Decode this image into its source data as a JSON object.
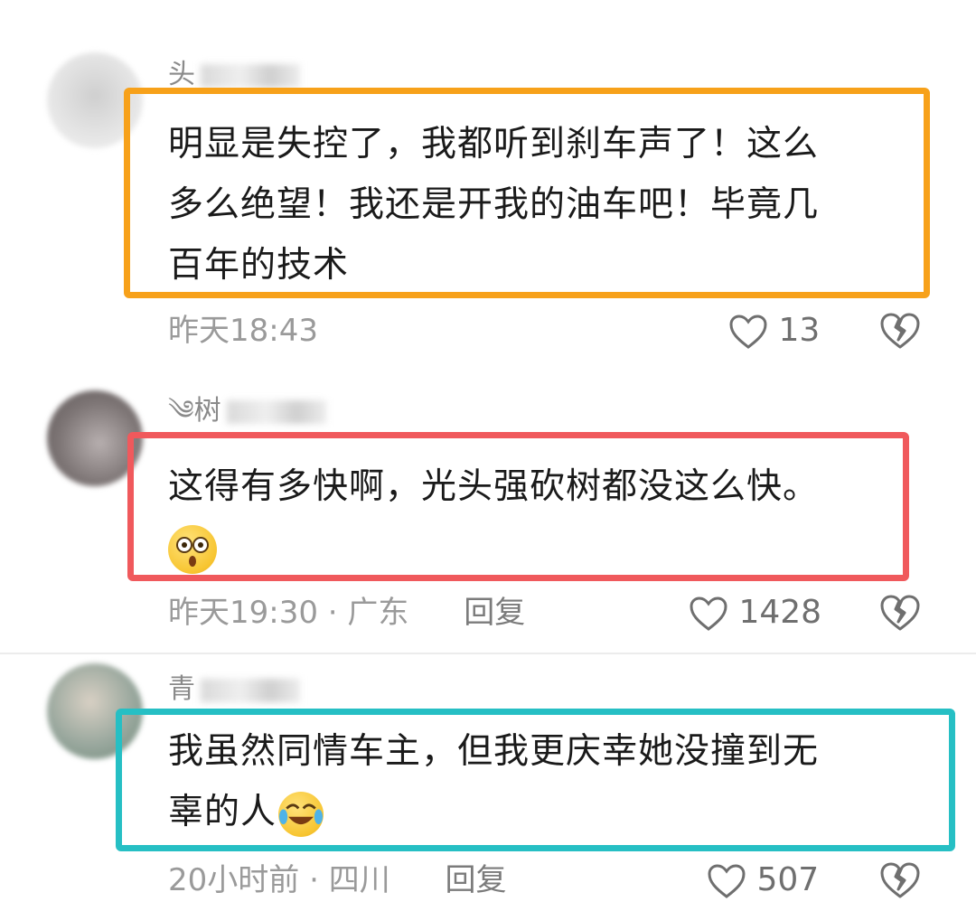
{
  "comments": [
    {
      "username": "头",
      "text_lines": [
        "明显是失控了，我都听到刹车声了！这么",
        "多么绝望！我还是开我的油车吧！毕竟几",
        "百年的技术"
      ],
      "time": "昨天18:43",
      "location": "",
      "reply_label": "",
      "likes": "13",
      "highlight_color": "#f7a11a",
      "avatar_colors": [
        "#d6d6d6",
        "#e8e8e8"
      ]
    },
    {
      "username": "༄树",
      "text_lines": [
        "这得有多快啊，光头强砍树都没这么快。"
      ],
      "emoji": "astonished-face-emoji",
      "time": "昨天19:30",
      "location": "广东",
      "reply_label": "回复",
      "likes": "1428",
      "highlight_color": "#f0595c",
      "avatar_colors": [
        "#7d7575",
        "#b7afaf"
      ]
    },
    {
      "username": "青",
      "text_lines": [
        "我虽然同情车主，但我更庆幸她没撞到无",
        "辜的人"
      ],
      "emoji": "tears-of-joy-emoji",
      "time": "20小时前",
      "location": "四川",
      "reply_label": "回复",
      "likes": "507",
      "highlight_color": "#26bfc4",
      "avatar_colors": [
        "#9aa89e",
        "#c9c2b6"
      ]
    }
  ],
  "separator": "·",
  "icons": {
    "like": "heart-outline-icon",
    "dislike": "broken-heart-icon"
  }
}
